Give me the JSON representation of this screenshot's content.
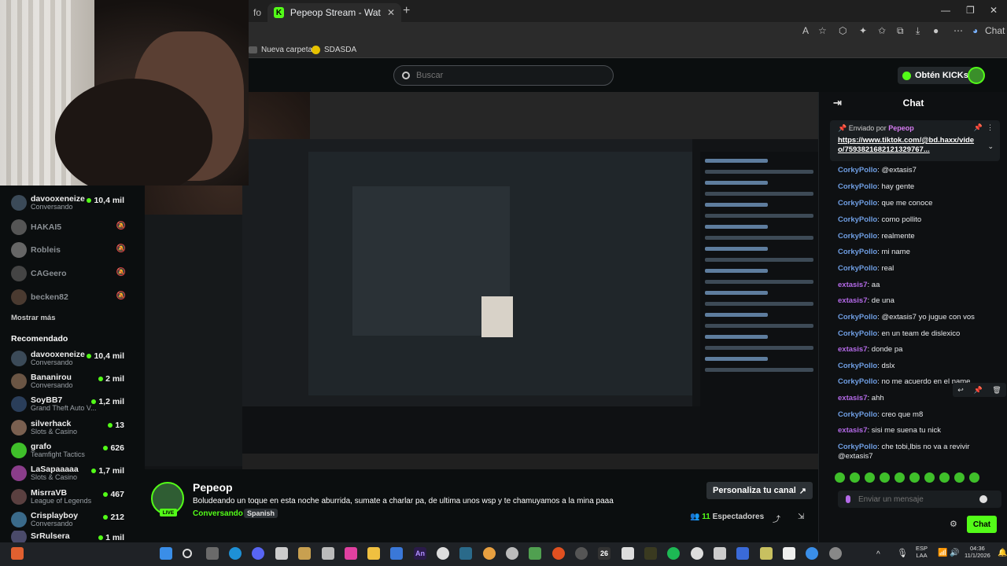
{
  "browser": {
    "prev_tab_label": "fo",
    "active_tab_title": "Pepeop Stream - Watch Live on Ki",
    "bookmarks": [
      "Nueva carpeta",
      "SDASDA"
    ]
  },
  "header": {
    "search_placeholder": "Buscar",
    "kicks_button": "Obtén KICKs"
  },
  "sidebar": {
    "following": [
      {
        "name": "davooxeneize",
        "sub": "Conversando",
        "viewers": "10,4 mil",
        "live": true
      },
      {
        "name": "HAKAI5",
        "sub": "",
        "viewers": "",
        "live": false
      },
      {
        "name": "Robleis",
        "sub": "",
        "viewers": "",
        "live": false
      },
      {
        "name": "CAGeero",
        "sub": "",
        "viewers": "",
        "live": false
      },
      {
        "name": "becken82",
        "sub": "",
        "viewers": "",
        "live": false
      }
    ],
    "show_more": "Mostrar más",
    "recommended_title": "Recomendado",
    "recommended": [
      {
        "name": "davooxeneize",
        "sub": "Conversando",
        "viewers": "10,4 mil"
      },
      {
        "name": "Bananirou",
        "sub": "Conversando",
        "viewers": "2 mil"
      },
      {
        "name": "SoyBB7",
        "sub": "Grand Theft Auto V...",
        "viewers": "1,2 mil"
      },
      {
        "name": "silverhack",
        "sub": "Slots & Casino",
        "viewers": "13"
      },
      {
        "name": "grafo",
        "sub": "Teamfight Tactics",
        "viewers": "626"
      },
      {
        "name": "LaSapaaaaa",
        "sub": "Slots & Casino",
        "viewers": "1,7 mil"
      },
      {
        "name": "MisrraVB",
        "sub": "League of Legends",
        "viewers": "467"
      },
      {
        "name": "Crisplayboy",
        "sub": "Conversando",
        "viewers": "212"
      },
      {
        "name": "SrRulsera",
        "sub": "",
        "viewers": "1 mil"
      }
    ]
  },
  "chat": {
    "title": "Chat",
    "pinned_by_label": "Enviado por",
    "pinned_by_user": "Pepeop",
    "pinned_link": "https://www.tiktok.com/@bd.haxx/video/7593821682121329767...",
    "messages": [
      {
        "user": "CorkyPollo",
        "text": "@extasis7",
        "color": "blue"
      },
      {
        "user": "CorkyPollo",
        "text": "hay gente",
        "color": "blue"
      },
      {
        "user": "CorkyPollo",
        "text": "que me conoce",
        "color": "blue"
      },
      {
        "user": "CorkyPollo",
        "text": "como pollito",
        "color": "blue"
      },
      {
        "user": "CorkyPollo",
        "text": "realmente",
        "color": "blue"
      },
      {
        "user": "CorkyPollo",
        "text": "mi name",
        "color": "blue"
      },
      {
        "user": "CorkyPollo",
        "text": "real",
        "color": "blue"
      },
      {
        "user": "extasis7",
        "text": "aa",
        "color": "purple"
      },
      {
        "user": "extasis7",
        "text": "de una",
        "color": "purple"
      },
      {
        "user": "CorkyPollo",
        "text": "@extasis7 yo jugue con vos",
        "color": "blue"
      },
      {
        "user": "CorkyPollo",
        "text": "en un team de dislexico",
        "color": "blue"
      },
      {
        "user": "extasis7",
        "text": "donde pa",
        "color": "purple"
      },
      {
        "user": "CorkyPollo",
        "text": "dslx",
        "color": "blue"
      },
      {
        "user": "CorkyPollo",
        "text": "no me acuerdo en el name",
        "color": "blue"
      },
      {
        "user": "extasis7",
        "text": "ahh",
        "color": "purple"
      },
      {
        "user": "CorkyPollo",
        "text": "creo que m8",
        "color": "blue"
      },
      {
        "user": "extasis7",
        "text": "sisi me suena tu nick",
        "color": "purple"
      },
      {
        "user": "CorkyPollo",
        "text": "che tobi,lbis no va a revivir @extasis7",
        "color": "blue"
      }
    ],
    "input_placeholder": "Enviar un mensaje",
    "send_button": "Chat"
  },
  "stream": {
    "streamer": "Pepeop",
    "live_label": "LIVE",
    "title": "Boludeando un toque en esta noche aburrida, sumate a charlar pa, de ultima unos wsp y te chamuyamos a la mina paaa",
    "category": "Conversando",
    "language": "Spanish",
    "customize_button": "Personaliza tu canal",
    "viewers_count": "11",
    "viewers_label": "Espectadores"
  },
  "taskbar": {
    "lang_top": "ESP",
    "lang_bottom": "LAA",
    "time": "04:36",
    "date": "11/1/2026"
  },
  "colors": {
    "kick_green": "#53fc18",
    "user_blue": "#6f9ee3",
    "user_purple": "#b46ae8",
    "bg": "#0b0e0f"
  }
}
